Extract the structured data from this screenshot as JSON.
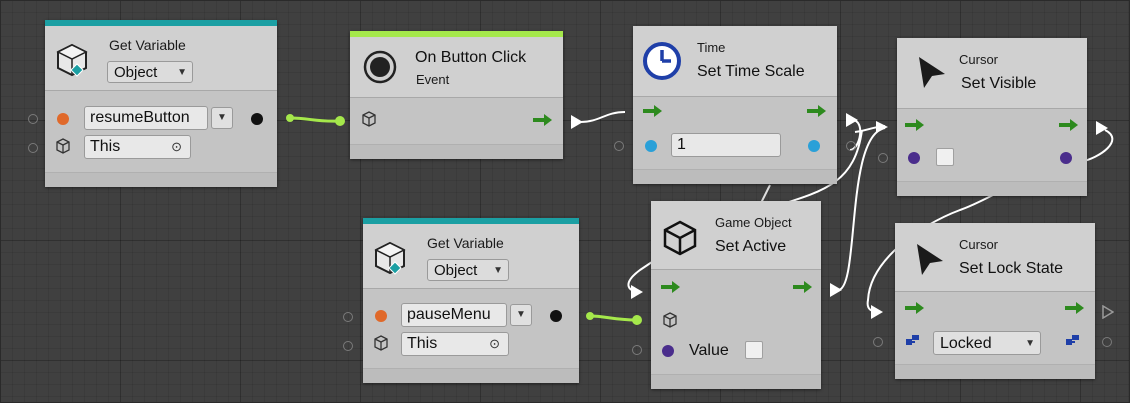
{
  "colors": {
    "variable_strip": "#1b9fa3",
    "event_strip": "#a5e84b",
    "control_port": "#2d8a1e",
    "object_port": "#e0692a",
    "float_port": "#2aa0d8",
    "bool_port": "#4a2d8c",
    "enum_port": "#1f3fa8",
    "wire_green": "#a5e84b",
    "wire_white": "#ffffff"
  },
  "nodes": {
    "get_variable_1": {
      "title": "Get Variable",
      "kind": "Object",
      "icon": "variables-cube-icon",
      "name_value": "resumeButton",
      "target_value": "This"
    },
    "on_button_click": {
      "title": "On Button Click",
      "subtitle": "Event",
      "icon": "event-dot-icon"
    },
    "set_time_scale": {
      "category": "Time",
      "title": "Set Time Scale",
      "icon": "clock-icon",
      "value": "1"
    },
    "cursor_set_visible": {
      "category": "Cursor",
      "title": "Set Visible",
      "icon": "cursor-arrow-icon",
      "visible_checked": false
    },
    "get_variable_2": {
      "title": "Get Variable",
      "kind": "Object",
      "icon": "variables-cube-icon",
      "name_value": "pauseMenu",
      "target_value": "This"
    },
    "set_active": {
      "category": "Game Object",
      "title": "Set Active",
      "icon": "cube-icon",
      "value_label": "Value",
      "value_checked": false
    },
    "cursor_set_lock_state": {
      "category": "Cursor",
      "title": "Set Lock State",
      "icon": "cursor-arrow-icon",
      "lock_value": "Locked"
    }
  }
}
